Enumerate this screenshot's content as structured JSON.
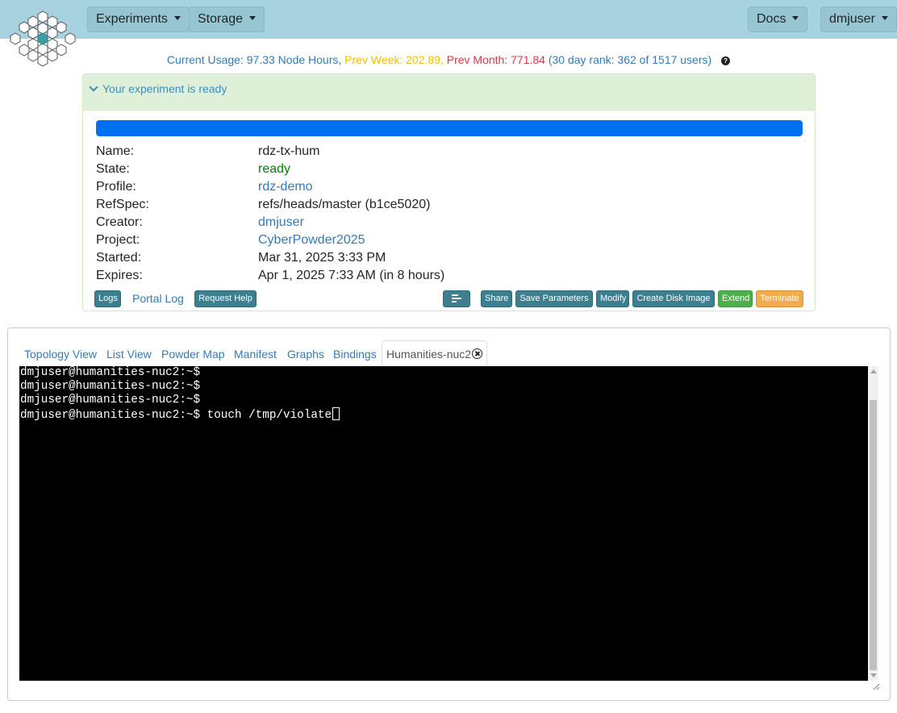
{
  "navbar": {
    "experiments_label": "Experiments",
    "storage_label": "Storage",
    "docs_label": "Docs",
    "user_label": "dmjuser",
    "bg_color": "#a6d3df"
  },
  "usage": {
    "current": "Current Usage: 97.33 Node Hours,",
    "prev_week": "Prev Week: 202.89,",
    "prev_month": "Prev Month: 771.84",
    "rank": "(30 day rank: 362 of 1517 users)",
    "help": "?"
  },
  "status_panel": {
    "header": "Your experiment is ready",
    "progress": 1.0,
    "rows": [
      {
        "label": "Name:",
        "value": "rdz-tx-hum"
      },
      {
        "label": "State:",
        "value": "ready"
      },
      {
        "label": "Profile:",
        "value": "rdz-demo"
      },
      {
        "label": "RefSpec:",
        "value": "refs/heads/master (b1ce5020)"
      },
      {
        "label": "Creator:",
        "value": "dmjuser"
      },
      {
        "label": "Project:",
        "value": "CyberPowder2025"
      },
      {
        "label": "Started:",
        "value": "Mar 31, 2025 3:33 PM"
      },
      {
        "label": "Expires:",
        "value": "Apr 1, 2025 7:33 AM (in 8 hours)"
      }
    ],
    "buttons": {
      "logs": "Logs",
      "portal_log": "Portal Log",
      "request_help": "Request Help",
      "share": "Share",
      "save_parameters": "Save Parameters",
      "modify": "Modify",
      "create_disk_image": "Create Disk Image",
      "extend": "Extend",
      "terminate": "Terminate"
    }
  },
  "tabs": [
    {
      "label": "Topology View"
    },
    {
      "label": "List View"
    },
    {
      "label": "Powder Map"
    },
    {
      "label": "Manifest"
    },
    {
      "label": "Graphs"
    },
    {
      "label": "Bindings"
    },
    {
      "label": "Humanities-nuc2",
      "active": true
    }
  ],
  "terminal": {
    "lines": [
      "dmjuser@humanities-nuc2:~$",
      "dmjuser@humanities-nuc2:~$",
      "dmjuser@humanities-nuc2:~$",
      "dmjuser@humanities-nuc2:~$ touch /tmp/violate"
    ]
  }
}
